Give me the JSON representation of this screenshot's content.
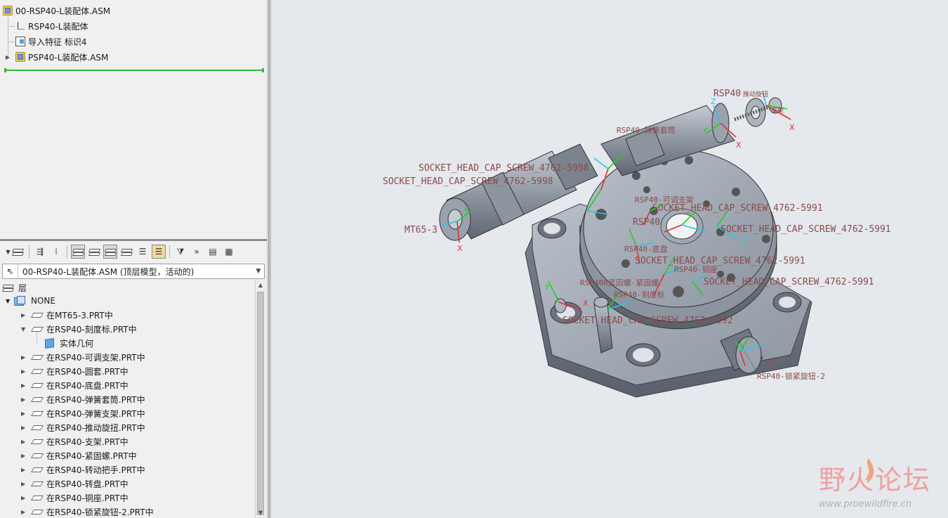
{
  "model_tree": {
    "root": "00-RSP40-L装配体.ASM",
    "items": [
      {
        "label": "RSP40-L装配体",
        "icon": "csys-icon"
      },
      {
        "label": "导入特征 标识4",
        "icon": "import-feature-icon"
      },
      {
        "label": "PSP40-L装配体.ASM",
        "icon": "assembly-icon"
      }
    ]
  },
  "layer_toolbar": {
    "icons": [
      "layers-icon",
      "tree-filter-icon",
      "settings-icon",
      "show-layer-icon",
      "hide-layer-icon",
      "isolate-layer-icon",
      "hidden-items-icon",
      "layer-list-icon",
      "layer-props-icon",
      "filter-icon",
      "more-icon",
      "columns-icon",
      "info-icon"
    ],
    "more_label": "»"
  },
  "model_select": {
    "value": "00-RSP40-L装配体.ASM (顶层模型，活动的)"
  },
  "layer_tree": {
    "header": "层",
    "none_label": "NONE",
    "items": [
      {
        "label": "在MT65-3.PRT中",
        "expanded": false
      },
      {
        "label": "在RSP40-刻度标.PRT中",
        "expanded": true,
        "child": "实体几何"
      },
      {
        "label": "在RSP40-可调支架.PRT中",
        "expanded": false
      },
      {
        "label": "在RSP40-圆套.PRT中",
        "expanded": false
      },
      {
        "label": "在RSP40-底盘.PRT中",
        "expanded": false
      },
      {
        "label": "在RSP40-弹簧套筒.PRT中",
        "expanded": false
      },
      {
        "label": "在RSP40-弹簧支架.PRT中",
        "expanded": false
      },
      {
        "label": "在RSP40-推动旋扭.PRT中",
        "expanded": false
      },
      {
        "label": "在RSP40-支架.PRT中",
        "expanded": false
      },
      {
        "label": "在RSP40-紧固螺.PRT中",
        "expanded": false
      },
      {
        "label": "在RSP40-转动把手.PRT中",
        "expanded": false
      },
      {
        "label": "在RSP40-转盘.PRT中",
        "expanded": false
      },
      {
        "label": "在RSP40-铜座.PRT中",
        "expanded": false
      },
      {
        "label": "在RSP40-锁紧旋钮-2.PRT中",
        "expanded": false
      }
    ]
  },
  "viewport": {
    "annotations": {
      "push_knob": "RSP40",
      "push_knob_suffix": "推动旋钮",
      "bracket_suffix": "支架",
      "spring_sleeve": "RSP40-弹簧套筒",
      "screw_1": "SOCKET_HEAD_CAP_SCREW_4762-5998",
      "screw_2": "SOCKET_HEAD_CAP_SCREW_4762-5998",
      "mt65": "MT65-3",
      "adj_bracket": "RSP40-可调支架",
      "screw_3": "SOCKET_HEAD_CAP_SCREW_4762-5991",
      "rsp40_a": "RSP40",
      "screw_4": "SOCKET_HEAD_CAP_SCREW_4762-5991",
      "base": "RSP40-底盘",
      "screw_5": "SOCKET_HEAD_CAP_SCREW_4762-5991",
      "copper_seat": "RSP40-铜座",
      "fastener": "RSP40R紧固螺-紧固螺",
      "screw_6": "SOCKET_HEAD_CAP_SCREW_4762-5991",
      "scale": "RSP40-刻度标",
      "screw_7": "SOCKET_HEAD_CAP_SCREW_4762-5992",
      "lock_knob": "RSP40-锁紧旋钮-2"
    },
    "colors": {
      "x_axis": "#e03030",
      "y_axis": "#20d020",
      "z_axis": "#20c8e8",
      "annotation": "#8a4b4b",
      "part": "#9aa2ae"
    }
  },
  "watermark": {
    "title": "野火论坛",
    "url": "www.proewildfire.cn"
  }
}
